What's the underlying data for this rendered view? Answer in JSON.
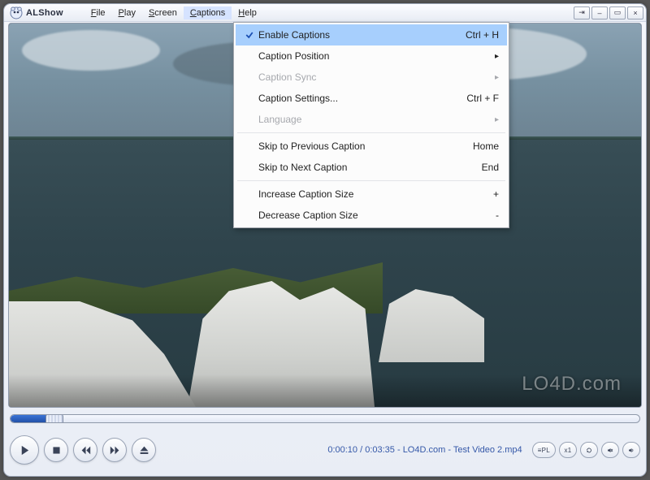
{
  "app": {
    "title": "ALShow",
    "menus": {
      "file": "File",
      "play": "Play",
      "screen": "Screen",
      "captions": "Captions",
      "help": "Help"
    },
    "active_menu": "captions"
  },
  "window_controls": {
    "pin": "⇥",
    "minimize": "–",
    "maximize": "▭",
    "close": "×"
  },
  "captions_menu": {
    "items": [
      {
        "label": "Enable Captions",
        "accel": "Ctrl + H",
        "checked": true
      },
      {
        "label": "Caption Position",
        "submenu": true
      },
      {
        "label": "Caption Sync",
        "submenu": true,
        "disabled": true
      },
      {
        "label": "Caption Settings...",
        "accel": "Ctrl + F"
      },
      {
        "label": "Language",
        "submenu": true,
        "disabled": true
      },
      {
        "sep": true
      },
      {
        "label": "Skip to Previous Caption",
        "accel": "Home"
      },
      {
        "label": "Skip to Next Caption",
        "accel": "End"
      },
      {
        "sep": true
      },
      {
        "label": "Increase Caption Size",
        "accel": "+"
      },
      {
        "label": "Decrease Caption Size",
        "accel": "-"
      }
    ]
  },
  "watermark": "LO4D.com",
  "playback": {
    "current": "0:00:10",
    "total": "0:03:35",
    "filename": "LO4D.com - Test Video 2.mp4",
    "status_line": "0:00:10 / 0:03:35 - LO4D.com - Test Video 2.mp4",
    "progress_pct": 4.7
  },
  "transport": {
    "play": "Play",
    "stop": "Stop",
    "prev": "Previous",
    "next": "Next",
    "eject": "Eject"
  },
  "right_controls": {
    "playlist": "PL",
    "speed": "x1",
    "repeat": "↻",
    "mute": "🔇",
    "volume": "🔊"
  }
}
